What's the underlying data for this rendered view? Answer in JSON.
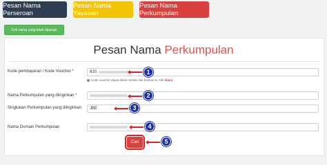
{
  "nav": {
    "perseroan": "Pesan Nama Perseroan",
    "yayasan": "Pesan Nama Yayasan",
    "perkumpulan": "Pesan Nama Perkumpulan"
  },
  "hint_button": "Cek nama yang telah dipesan",
  "form": {
    "title_main": "Pesan Nama",
    "title_accent": "Perkumpulan",
    "voucher_label": "Kode pembayaran / Kode Voucher *",
    "voucher_value": "820",
    "voucher_note": "Kode voucher dapat dibeli melalui link berikut ini, klik",
    "voucher_link": "disini",
    "nama_label": "Nama Perkumpulan yang diinginkan *",
    "singkatan_label": "Singkatan Perkumpulan yang diinginkan",
    "singkatan_value": "JBE",
    "domain_label": "Nama Domain Perkumpulan",
    "submit": "Cari"
  },
  "steps": [
    "1",
    "2",
    "3",
    "4",
    "5"
  ],
  "colors": {
    "perseroan": "#2e3d4f",
    "yayasan": "#f5c400",
    "perkumpulan": "#d8413d",
    "hint": "#5cb85c",
    "accent": "#e3514a",
    "badge": "#1b2fa8"
  }
}
